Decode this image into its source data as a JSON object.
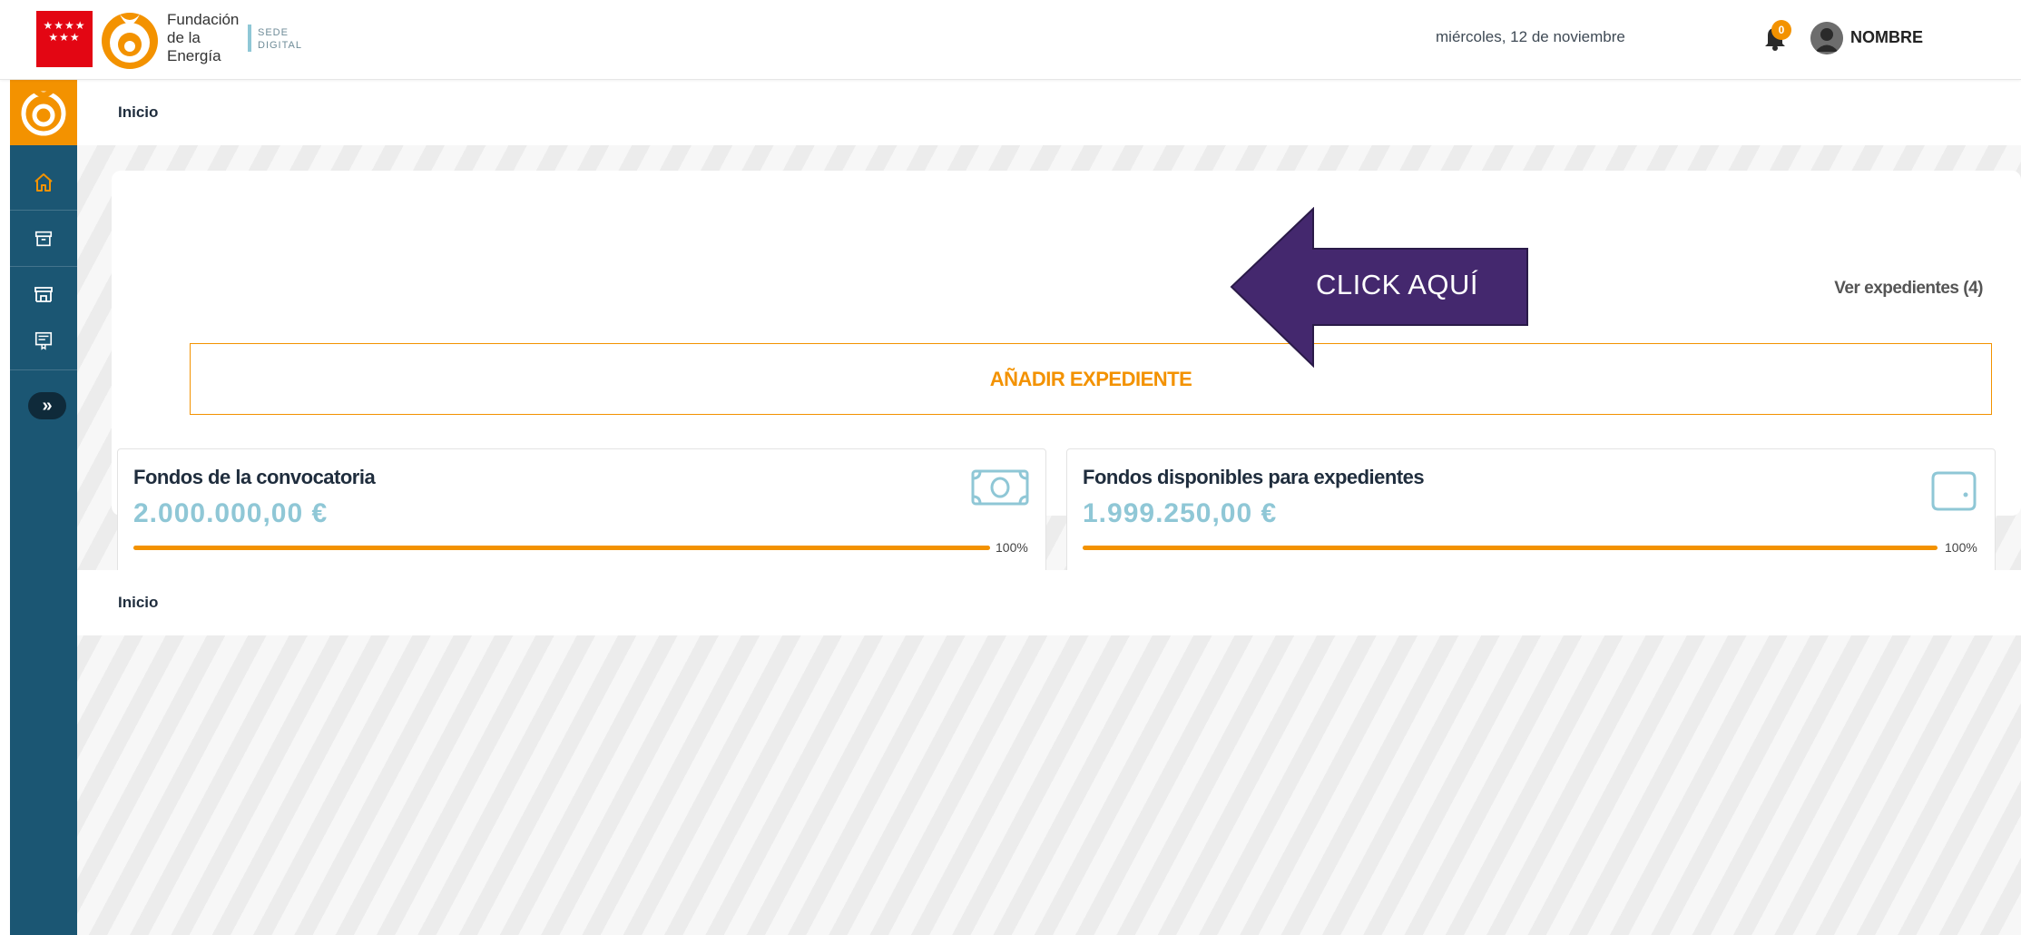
{
  "header": {
    "brand_text": "Fundación de la Energía",
    "brand_line1": "Fundación",
    "brand_line2": "de la",
    "brand_line3": "Energía",
    "sede_line1": "SEDE",
    "sede_line2": "DIGITAL",
    "date": "miércoles, 12 de noviembre",
    "notifications_count": "0",
    "user_name": "NOMBRE"
  },
  "sidebar": {
    "items": [
      {
        "icon": "home-icon"
      },
      {
        "icon": "archive-icon"
      },
      {
        "icon": "store-icon"
      },
      {
        "icon": "certificate-icon"
      }
    ],
    "expand_label": "»"
  },
  "main": {
    "breadcrumb_top": "Inicio",
    "breadcrumb_bottom": "Inicio",
    "ver_expedientes": "Ver expedientes (4)",
    "add_button": "AÑADIR EXPEDIENTE",
    "cards": [
      {
        "title": "Fondos de la convocatoria",
        "amount": "2.000.000,00 €",
        "percent_label": "100%",
        "progress": 1.0,
        "icon": "money-bill-icon"
      },
      {
        "title": "Fondos disponibles para expedientes",
        "amount": "1.999.250,00 €",
        "percent_label": "100%",
        "progress": 1.0,
        "icon": "wallet-icon"
      }
    ]
  },
  "annotation": {
    "label": "CLICK AQUÍ"
  },
  "colors": {
    "accent": "#f39200",
    "sidebar": "#1b5673",
    "amount": "#8fc7d6",
    "annotation_arrow": "#44286e",
    "region_flag": "#e30613"
  }
}
